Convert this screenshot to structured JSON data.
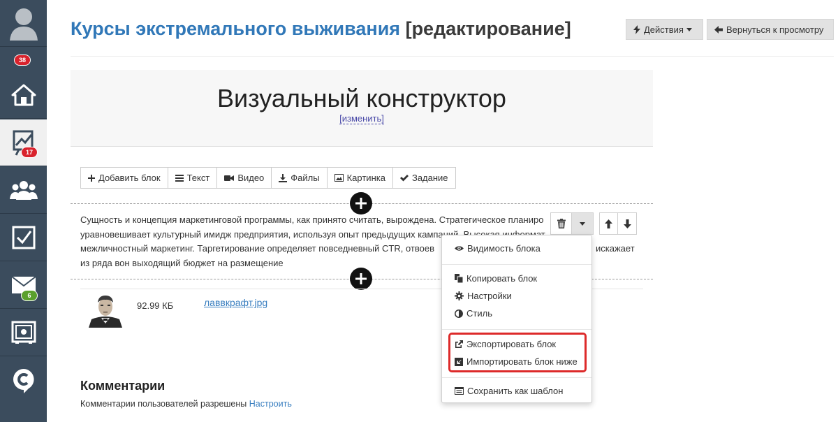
{
  "sidebar": {
    "badges": {
      "profile": "38",
      "stats": "17",
      "messages": "6"
    },
    "items": [
      "avatar-icon",
      "home-icon",
      "chart-icon",
      "users-icon",
      "tasks-icon",
      "mail-icon",
      "safe-icon",
      "chat-icon"
    ]
  },
  "header": {
    "course": "Курсы экстремального выживания",
    "mode": "[редактирование]",
    "actions_label": "Действия",
    "back_label": "Вернуться к просмотру"
  },
  "hero": {
    "title": "Визуальный конструктор",
    "change_label": "[изменить]"
  },
  "toolbar": {
    "add_block": "Добавить блок",
    "text": "Текст",
    "video": "Видео",
    "files": "Файлы",
    "image": "Картинка",
    "task": "Задание"
  },
  "block_text": {
    "line1": "Сущность и концепция маркетинговой программы, как принято считать, вырождена. Стратегическое планиро",
    "line2": "уравновешивает культурный имидж предприятия, используя опыт предыдущих кампаний. Высокая информат",
    "line3": "межличностный маркетинг. Таргетирование определяет повседневный CTR, отвоев",
    "line3_tail": "искажает",
    "line4": "из ряда вон выходящий бюджет на размещение"
  },
  "menu": {
    "visibility": "Видимость блока",
    "copy": "Копировать блок",
    "settings": "Настройки",
    "style": "Стиль",
    "export": "Экспортировать блок",
    "import": "Импортировать блок ниже",
    "save_template": "Сохранить как шаблон"
  },
  "file": {
    "size": "92.99 КБ",
    "name": "лаввкрафт.jpg"
  },
  "comments": {
    "title": "Комментарии",
    "text": "Комментарии пользователей разрешены",
    "link": "Настроить"
  },
  "colors": {
    "sidebar_bg": "#3b4c5d",
    "title_blue": "#3178b8",
    "highlight_red": "#dd2a2a",
    "badge_red": "#d9232d",
    "badge_green": "#5aa02c"
  }
}
